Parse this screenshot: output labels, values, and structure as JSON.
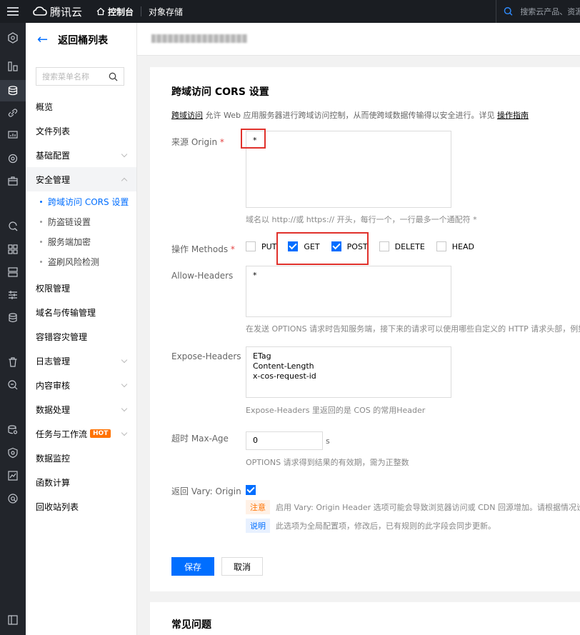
{
  "topbar": {
    "logo": "腾讯云",
    "console": "控制台",
    "cos": "对象存储",
    "search_placeholder": "搜索云产品、资源"
  },
  "sidebar": {
    "back_label": "返回桶列表",
    "search_placeholder": "搜索菜单名称",
    "items": [
      {
        "label": "概览"
      },
      {
        "label": "文件列表"
      },
      {
        "label": "基础配置"
      },
      {
        "label": "安全管理"
      },
      {
        "label": "权限管理"
      },
      {
        "label": "域名与传输管理"
      },
      {
        "label": "容错容灾管理"
      },
      {
        "label": "日志管理"
      },
      {
        "label": "内容审核"
      },
      {
        "label": "数据处理"
      },
      {
        "label": "任务与工作流"
      },
      {
        "label": "数据监控"
      },
      {
        "label": "函数计算"
      },
      {
        "label": "回收站列表"
      }
    ],
    "security_sub": [
      {
        "label": "跨域访问 CORS 设置"
      },
      {
        "label": "防盗链设置"
      },
      {
        "label": "服务端加密"
      },
      {
        "label": "盗刷风险检测"
      }
    ],
    "hot_badge": "HOT"
  },
  "form": {
    "title": "跨域访问 CORS 设置",
    "desc_link": "跨域访问",
    "desc_text": " 允许 Web 应用服务器进行跨域访问控制，从而使跨域数据传输得以安全进行。详见 ",
    "desc_guide": "操作指南",
    "origin_label": "来源 Origin",
    "required_mark": "*",
    "origin_value": "*",
    "origin_hint": "域名以 http://或 https:// 开头，每行一个，一行最多一个通配符 *",
    "methods_label": "操作 Methods",
    "methods": [
      {
        "label": "PUT",
        "checked": false
      },
      {
        "label": "GET",
        "checked": true
      },
      {
        "label": "POST",
        "checked": true
      },
      {
        "label": "DELETE",
        "checked": false
      },
      {
        "label": "HEAD",
        "checked": false
      }
    ],
    "allow_headers_label": "Allow-Headers",
    "allow_headers_value": "*",
    "allow_headers_hint": "在发送 OPTIONS 请求时告知服务端，接下来的请求可以使用哪些自定义的 HTTP 请求头部，例如",
    "expose_headers_label": "Expose-Headers",
    "expose_headers_lines": [
      "ETag",
      "Content-Length",
      "x-cos-request-id"
    ],
    "expose_headers_hint": "Expose-Headers 里返回的是 COS 的常用Header",
    "max_age_label": "超时 Max-Age",
    "max_age_value": "0",
    "max_age_unit": "s",
    "max_age_hint": "OPTIONS 请求得到结果的有效期，需为正整数",
    "vary_label": "返回 Vary: Origin",
    "vary_checked": true,
    "note_tag": "注意",
    "note_text": "启用 Vary: Origin Header 选项可能会导致浏览器访问或 CDN 回源增加。请根据情况设置",
    "info_tag": "说明",
    "info_text": "此选项为全局配置项，修改后，已有规则的此字段会同步更新。",
    "save_label": "保存",
    "cancel_label": "取消"
  },
  "faq": {
    "title": "常见问题"
  },
  "colors": {
    "accent": "#006eff",
    "topbar": "#1a1d22",
    "highlight": "#e0312b"
  }
}
